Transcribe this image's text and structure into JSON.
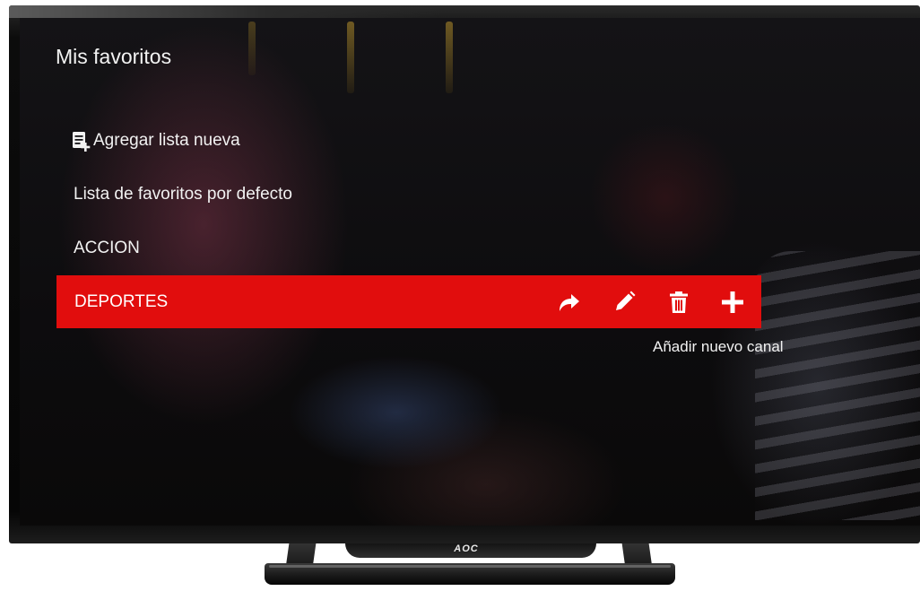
{
  "menu": {
    "title": "Mis favoritos",
    "add_list_label": "Agregar lista nueva",
    "items": [
      {
        "label": "Lista de favoritos por defecto"
      },
      {
        "label": "ACCION"
      }
    ],
    "selected": {
      "label": "DEPORTES",
      "actions": [
        "move-icon",
        "edit-icon",
        "trash-icon",
        "plus-icon"
      ]
    },
    "tooltip": "Añadir nuevo canal"
  },
  "tv": {
    "brand": "AOC"
  },
  "colors": {
    "highlight": "#e10d0d",
    "text": "#f2f2f2"
  }
}
